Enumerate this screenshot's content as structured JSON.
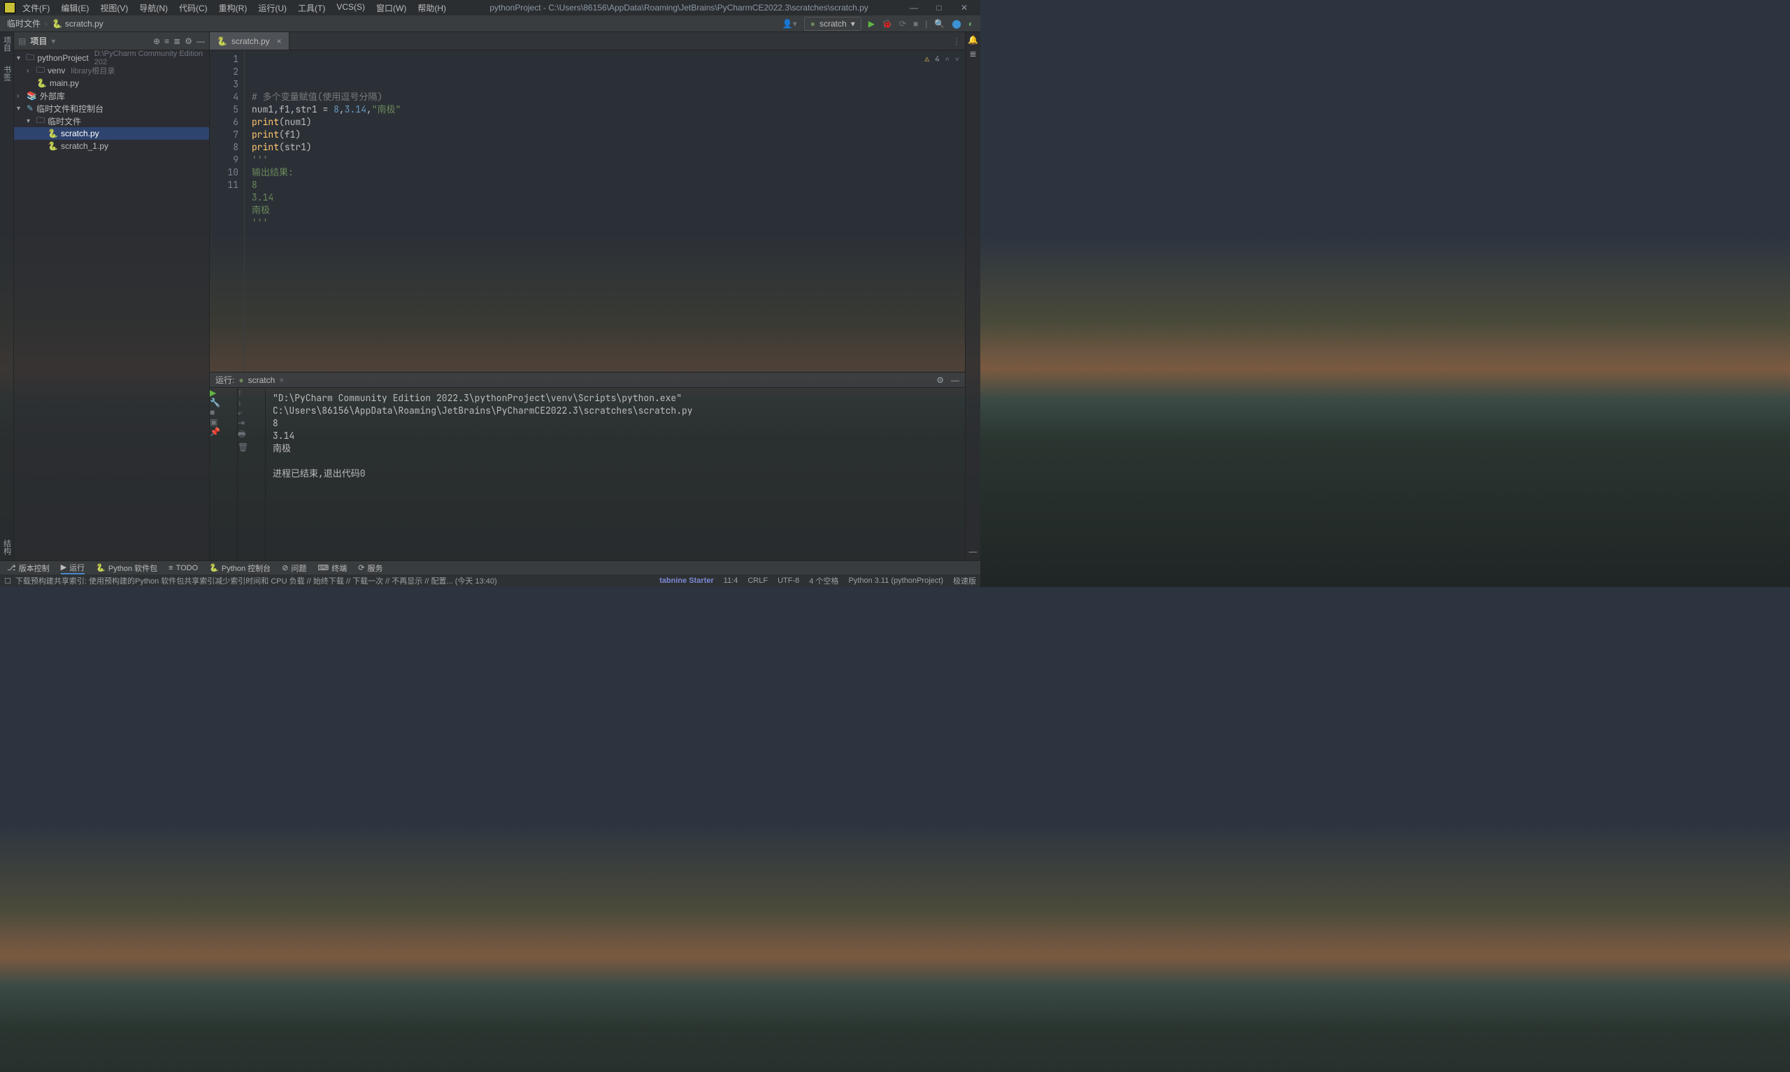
{
  "title": "pythonProject - C:\\Users\\86156\\AppData\\Roaming\\JetBrains\\PyCharmCE2022.3\\scratches\\scratch.py",
  "menu": [
    "文件(F)",
    "编辑(E)",
    "视图(V)",
    "导航(N)",
    "代码(C)",
    "重构(R)",
    "运行(U)",
    "工具(T)",
    "VCS(S)",
    "窗口(W)",
    "帮助(H)"
  ],
  "breadcrumb": [
    "临时文件",
    "scratch.py"
  ],
  "run_config": "scratch",
  "project_header": "项目",
  "left_rail": {
    "project_label": "项目",
    "bookmark_label": "书签",
    "structure_label": "结构"
  },
  "tree": [
    {
      "type": "folder",
      "label": "pythonProject",
      "hint": "D:\\PyCharm Community Edition 202",
      "indent": 0,
      "open": true,
      "arrow": "▾"
    },
    {
      "type": "folder",
      "label": "venv",
      "hint": "library根目录",
      "indent": 1,
      "open": false,
      "arrow": "›"
    },
    {
      "type": "py",
      "label": "main.py",
      "indent": 1
    },
    {
      "type": "lib",
      "label": "外部库",
      "indent": 0,
      "arrow": "›"
    },
    {
      "type": "scratch",
      "label": "临时文件和控制台",
      "indent": 0,
      "open": true,
      "arrow": "▾"
    },
    {
      "type": "folder",
      "label": "临时文件",
      "indent": 1,
      "open": true,
      "arrow": "▾"
    },
    {
      "type": "py",
      "label": "scratch.py",
      "indent": 2,
      "selected": true
    },
    {
      "type": "py",
      "label": "scratch_1.py",
      "indent": 2
    }
  ],
  "tab": {
    "label": "scratch.py"
  },
  "warnings_badge": "4",
  "line_count": 11,
  "code_lines": [
    {
      "n": 1,
      "html": "<span class='c-comment'># 多个变量赋值(使用逗号分隔)</span>"
    },
    {
      "n": 2,
      "html": "<span class='c-ident'>num1</span><span class='c-op'>,</span><span class='c-ident'>f1</span><span class='c-op'>,</span><span class='c-ident'>str1</span> <span class='c-op'>=</span> <span class='c-num'>8</span><span class='c-op'>,</span><span class='c-num'>3.14</span><span class='c-op'>,</span><span class='c-str'>\"南极\"</span>"
    },
    {
      "n": 3,
      "html": "<span class='c-func'>print</span>(<span class='c-ident'>num1</span>)"
    },
    {
      "n": 4,
      "html": "<span class='c-func'>print</span>(<span class='c-ident'>f1</span>)"
    },
    {
      "n": 5,
      "html": "<span class='c-func'>print</span>(<span class='c-ident'>str1</span>)"
    },
    {
      "n": 6,
      "html": "<span class='c-str'>'''</span>"
    },
    {
      "n": 7,
      "html": "<span class='c-str'>输出结果:</span>"
    },
    {
      "n": 8,
      "html": "<span class='c-str'>8</span>"
    },
    {
      "n": 9,
      "html": "<span class='c-str'>3.14</span>"
    },
    {
      "n": 10,
      "html": "<span class='c-str'>南极</span>"
    },
    {
      "n": 11,
      "html": "<span class='c-str'>'''</span>"
    }
  ],
  "run_header_label": "运行:",
  "run_tab": "scratch",
  "console_lines": [
    "\"D:\\PyCharm Community Edition 2022.3\\pythonProject\\venv\\Scripts\\python.exe\" C:\\Users\\86156\\AppData\\Roaming\\JetBrains\\PyCharmCE2022.3\\scratches\\scratch.py",
    "8",
    "3.14",
    "南极",
    "",
    "进程已结束,退出代码0"
  ],
  "bottom_tools": [
    {
      "icon": "git",
      "label": "版本控制"
    },
    {
      "icon": "run",
      "label": "运行",
      "active": true
    },
    {
      "icon": "pkg",
      "label": "Python 软件包"
    },
    {
      "icon": "todo",
      "label": "TODO"
    },
    {
      "icon": "py",
      "label": "Python 控制台"
    },
    {
      "icon": "problem",
      "label": "问题"
    },
    {
      "icon": "term",
      "label": "终端"
    },
    {
      "icon": "svc",
      "label": "服务"
    }
  ],
  "status": {
    "left": "下载预构建共享索引: 使用预构建的Python 软件包共享索引减少索引时间和 CPU 负载 // 始终下载 // 下载一次 // 不再显示 // 配置... (今天 13:40)",
    "tabnine": "tabnine Starter",
    "pos": "11:4",
    "sep": "CRLF",
    "enc": "UTF-8",
    "indent": "4 个空格",
    "interp": "Python 3.11 (pythonProject)",
    "trailing": "极速版"
  }
}
